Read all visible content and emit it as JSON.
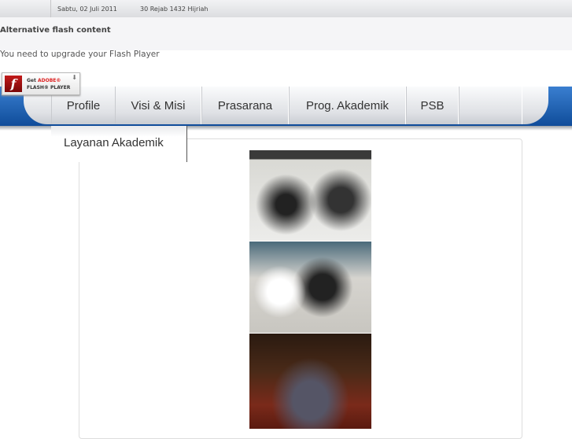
{
  "topbar": {
    "date": "Sabtu, 02 Juli 2011",
    "hijri": "30 Rejab 1432 Hijriah"
  },
  "flash": {
    "title": "Alternative flash content",
    "message": "You need to upgrade your Flash Player",
    "badge_get": "Get",
    "badge_adobe": "ADOBE®",
    "badge_player": "FLASH® PLAYER"
  },
  "nav": {
    "items": [
      {
        "label": "Profile"
      },
      {
        "label": "Visi & Misi"
      },
      {
        "label": "Prasarana"
      },
      {
        "label": "Prog. Akademik"
      },
      {
        "label": "PSB"
      }
    ],
    "submenu": {
      "label": "Layanan Akademik"
    }
  }
}
